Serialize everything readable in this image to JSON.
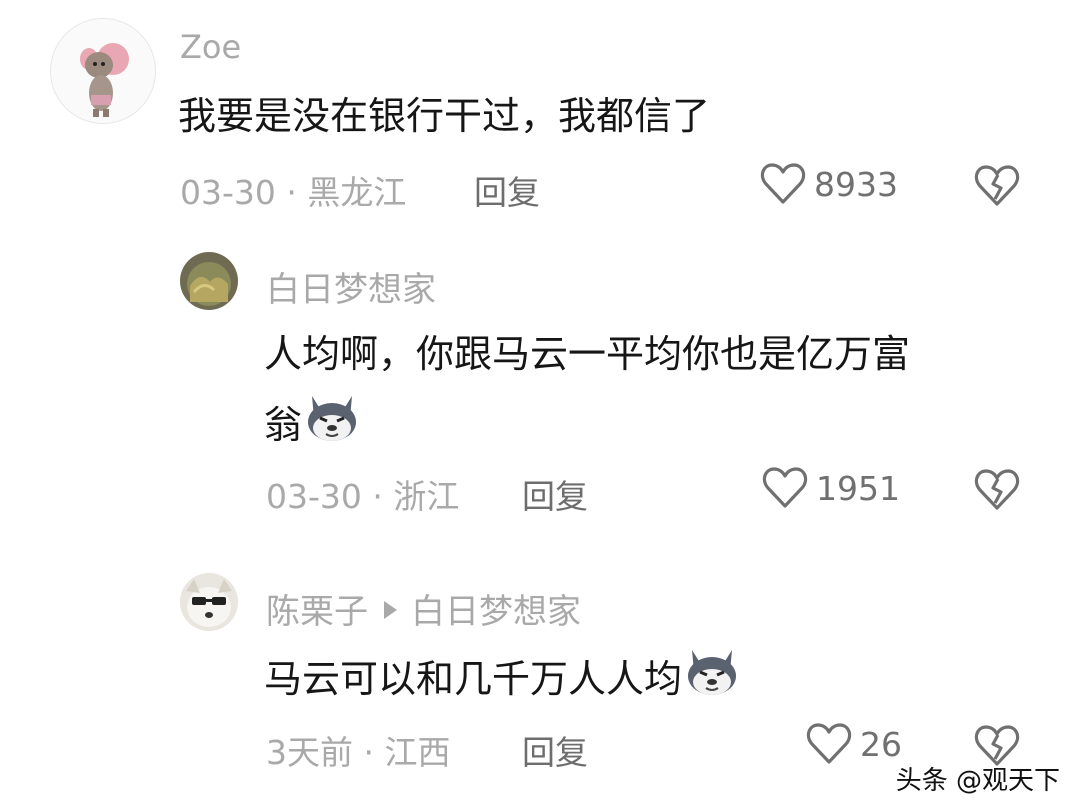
{
  "comments": [
    {
      "username": "Zoe",
      "text": "我要是没在银行干过，我都信了",
      "date": "03-30",
      "location": "黑龙江",
      "reply_label": "回复",
      "likes": "8933"
    },
    {
      "username": "白日梦想家",
      "text_line1": "人均啊，你跟马云一平均你也是亿万富",
      "text_line2": "翁",
      "date": "03-30",
      "location": "浙江",
      "reply_label": "回复",
      "likes": "1951"
    },
    {
      "username": "陈栗子",
      "reply_to": "白日梦想家",
      "text": "马云可以和几千万人人均",
      "date": "3天前",
      "location": "江西",
      "reply_label": "回复",
      "likes": "26"
    }
  ],
  "separator": "·",
  "watermark": "头条 @观天下",
  "icons": {
    "like": "heart-outline-icon",
    "dislike": "broken-heart-icon",
    "emoji": "husky-dog-emoji"
  },
  "colors": {
    "text": "#161616",
    "muted": "#a9a9a9",
    "icon": "#707070"
  }
}
